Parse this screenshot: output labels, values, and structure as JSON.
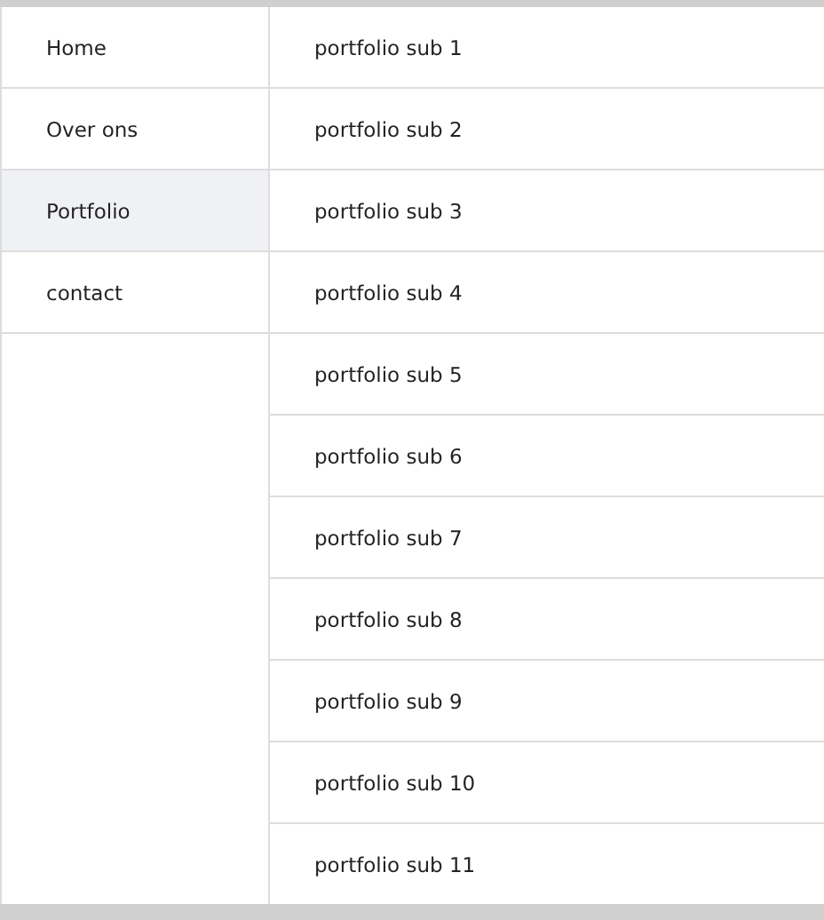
{
  "menu": [
    {
      "label": "Home",
      "selected": false
    },
    {
      "label": "Over ons",
      "selected": false
    },
    {
      "label": "Portfolio",
      "selected": true
    },
    {
      "label": "contact",
      "selected": false
    }
  ],
  "submenu": [
    "portfolio sub 1",
    "portfolio sub 2",
    "portfolio sub 3",
    "portfolio sub 4",
    "portfolio sub 5",
    "portfolio sub 6",
    "portfolio sub 7",
    "portfolio sub 8",
    "portfolio sub 9",
    "portfolio sub 10",
    "portfolio sub 11"
  ]
}
